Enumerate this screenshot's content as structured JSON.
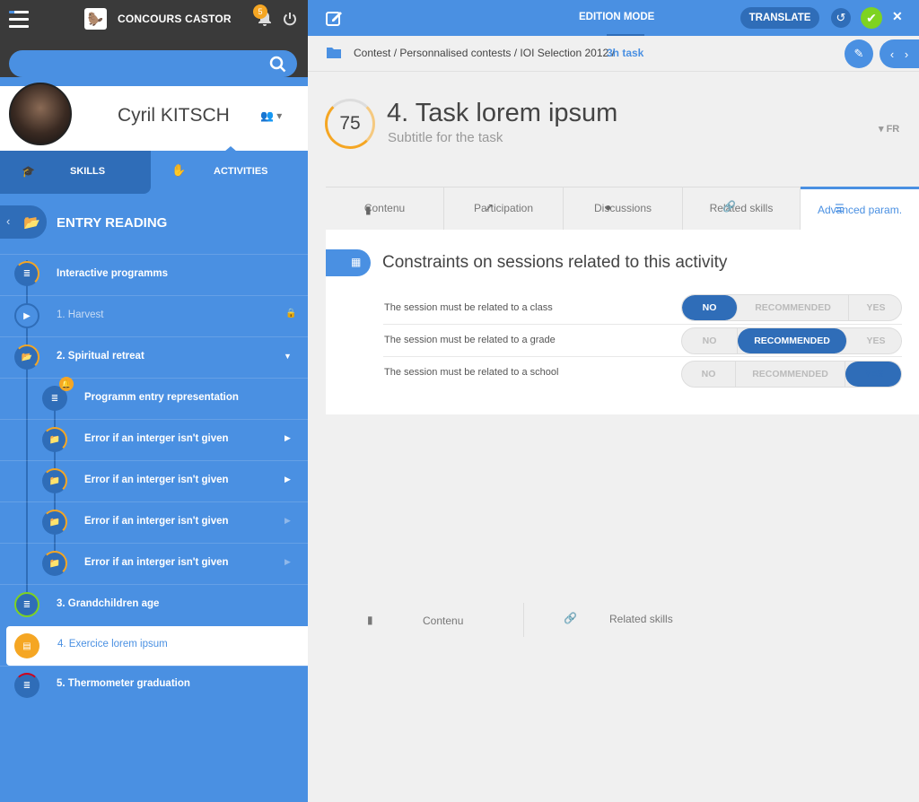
{
  "app": {
    "title": "CONCOURS CASTOR",
    "notifications": "5"
  },
  "user": {
    "name": "Cyril KITSCH"
  },
  "sidebar": {
    "tabs": [
      {
        "label": "SKILLS"
      },
      {
        "label": "ACTIVITIES"
      }
    ],
    "section_title": "ENTRY READING",
    "items": [
      {
        "label": "Interactive programms"
      },
      {
        "label": "1. Harvest"
      },
      {
        "label": "2. Spiritual retreat"
      },
      {
        "label": "Programm entry representation"
      },
      {
        "label": "Error if an interger isn't given"
      },
      {
        "label": "Error if an interger isn't given"
      },
      {
        "label": "Error if an interger isn't given"
      },
      {
        "label": "Error if an interger isn't given"
      },
      {
        "label": "3. Grandchildren age"
      },
      {
        "label": "4. Exercice lorem ipsum"
      },
      {
        "label": "5. Thermometer graduation"
      }
    ]
  },
  "header": {
    "mode": "EDITION MODE",
    "translate": "TRANSLATE"
  },
  "breadcrumb": {
    "path": "Contest / Personnalised contests / IOI Selection 2012 /",
    "current": "3h task"
  },
  "task": {
    "score": "75",
    "title": "4. Task lorem ipsum",
    "subtitle": "Subtitle for the task",
    "lang": "FR"
  },
  "task_tabs": [
    {
      "label": "Contenu"
    },
    {
      "label": "Participation"
    },
    {
      "label": "Discussions"
    },
    {
      "label": "Related skills"
    },
    {
      "label": "Advanced param."
    }
  ],
  "panel": {
    "title": "Constraints on sessions related to this activity",
    "constraints": [
      {
        "label": "The session must be related to a class",
        "selected": "NO"
      },
      {
        "label": "The session must be related to a grade",
        "selected": "RECOMMENDED"
      },
      {
        "label": "The session must be related to a school",
        "selected": "YES"
      }
    ],
    "options": {
      "no": "NO",
      "recommended": "RECOMMENDED",
      "yes": "YES"
    }
  },
  "bottom_tabs": [
    {
      "label": "Contenu"
    },
    {
      "label": "Related skills"
    }
  ],
  "colors": {
    "accent": "#4a90e2",
    "dark_accent": "#2f6db8",
    "orange": "#f5a623",
    "green": "#7ed321"
  }
}
